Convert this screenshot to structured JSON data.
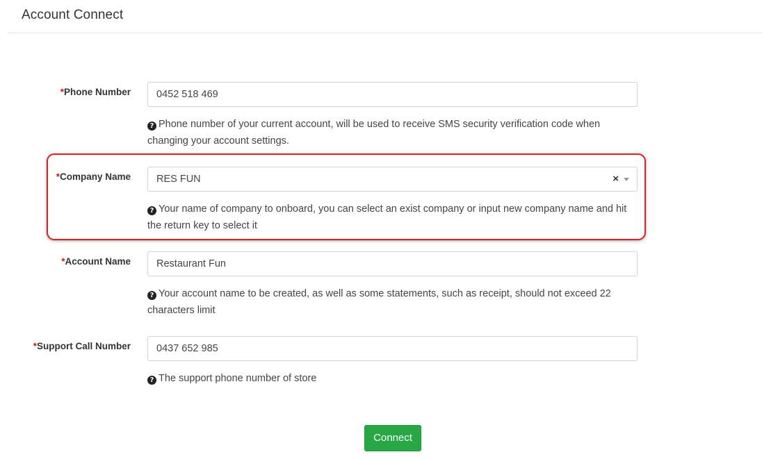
{
  "header": {
    "title": "Account Connect"
  },
  "form": {
    "required_mark": "*",
    "phone": {
      "label": "Phone Number",
      "value": "0452 518 469",
      "help": "Phone number of your current account, will be used to receive SMS security verification code when changing your account settings."
    },
    "company": {
      "label": "Company Name",
      "value": "RES FUN",
      "clear_glyph": "×",
      "help": "Your name of company to onboard, you can select an exist company or input new company name and hit the return key to select it"
    },
    "account": {
      "label": "Account Name",
      "value": "Restaurant Fun",
      "help": "Your account name to be created, as well as some statements, such as receipt, should not exceed 22 characters limit"
    },
    "support": {
      "label": "Support Call Number",
      "value": "0437 652 985",
      "help": "The support phone number of store"
    },
    "help_icon": "question-circle-icon",
    "help_icon_glyph": "?",
    "submit_label": "Connect"
  },
  "colors": {
    "required": "#d9141b",
    "highlight_border": "#e01e1e",
    "button_bg": "#28a745"
  }
}
